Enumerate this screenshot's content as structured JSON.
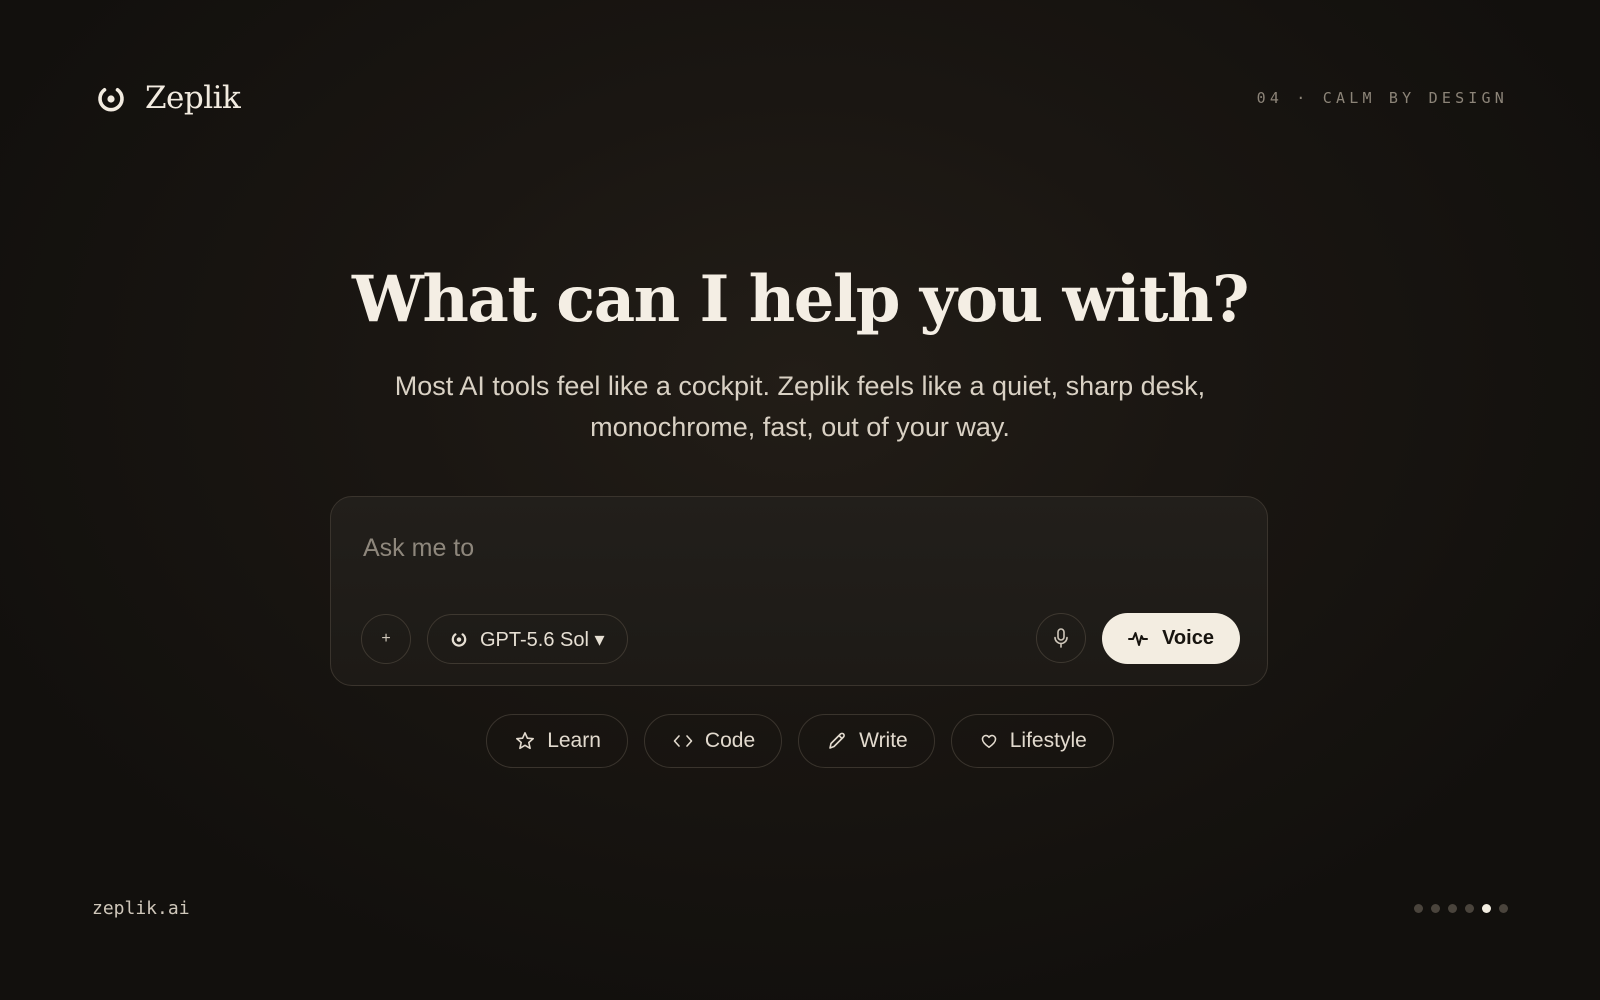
{
  "brand": {
    "name": "Zeplik",
    "logo_icon": "zeplik-logo-icon"
  },
  "header": {
    "tagline": "04 · CALM BY DESIGN"
  },
  "hero": {
    "title": "What can I help you with?",
    "subtitle_line1": "Most AI tools feel like a cockpit. Zeplik feels like a quiet, sharp desk,",
    "subtitle_line2": "monochrome, fast, out of your way."
  },
  "composer": {
    "placeholder": "Ask me to",
    "value": "",
    "attach_label": "+",
    "model_label": "GPT-5.6 Sol ▾",
    "voice_label": "Voice",
    "icons": {
      "attach": "plus-icon",
      "model": "zeplik-logo-icon",
      "mic": "microphone-icon",
      "voice": "waveform-icon"
    }
  },
  "chips": [
    {
      "label": "Learn",
      "icon": "star-icon"
    },
    {
      "label": "Code",
      "icon": "code-icon"
    },
    {
      "label": "Write",
      "icon": "pencil-icon"
    },
    {
      "label": "Lifestyle",
      "icon": "heart-icon"
    }
  ],
  "footer": {
    "url": "zeplik.ai",
    "pager": {
      "total": 6,
      "current": 5
    }
  },
  "colors": {
    "background": "#1a1612",
    "text": "#ede6da",
    "muted": "#8c8478",
    "voice_button": "#f3ede1",
    "border": "#3a342d"
  }
}
